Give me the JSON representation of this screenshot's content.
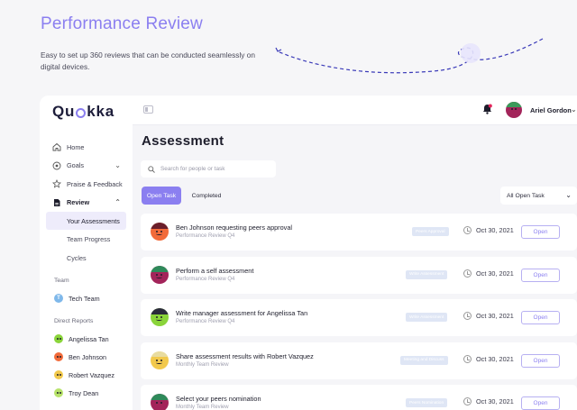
{
  "hero": {
    "title": "Performance Review",
    "subtitle": "Easy to set up 360 reviews that can be conducted seamlessly on digital devices."
  },
  "brand": {
    "logo_prefix": "Qu",
    "logo_suffix": "kka",
    "accent": "#8b7ff0"
  },
  "sidebar": {
    "nav": [
      {
        "label": "Home",
        "icon": "home-icon"
      },
      {
        "label": "Goals",
        "icon": "target-icon"
      },
      {
        "label": "Praise & Feedback",
        "icon": "star-icon"
      },
      {
        "label": "Review",
        "icon": "document-icon"
      }
    ],
    "review_sub": [
      "Your Assessments",
      "Team Progress",
      "Cycles"
    ],
    "team_label": "Team",
    "team": {
      "initial": "T",
      "name": "Tech Team"
    },
    "reports_label": "Direct Reports",
    "reports": [
      "Angelissa Tan",
      "Ben Johnson",
      "Robert Vazquez",
      "Troy Dean"
    ]
  },
  "topbar": {
    "user_name": "Ariel Gordon"
  },
  "main": {
    "title": "Assessment",
    "search_placeholder": "Search for people or task",
    "tabs": {
      "open": "Open Task",
      "completed": "Completed"
    },
    "filter": "All Open Task",
    "open_label": "Open",
    "tasks": [
      {
        "title": "Ben Johnson requesting peers approval",
        "subtitle": "Performance Review Q4",
        "badge": "Peers Approval",
        "date": "Oct 30, 2021",
        "avatar_color": "#f26b3a"
      },
      {
        "title": "Perform a self assessment",
        "subtitle": "Performance Review Q4",
        "badge": "Write Assessment",
        "date": "Oct 30, 2021",
        "avatar_color": "#a3245a"
      },
      {
        "title": "Write manager assessment for Angelissa Tan",
        "subtitle": "Performance Review Q4",
        "badge": "Write Assessment",
        "date": "Oct 30, 2021",
        "avatar_color": "#8ad43a"
      },
      {
        "title": "Share assessment results with Robert Vazquez",
        "subtitle": "Monthly Team Review",
        "badge": "Meeting and Discuss",
        "date": "Oct 30, 2021",
        "avatar_color": "#f2c94c"
      },
      {
        "title": "Select your peers nomination",
        "subtitle": "Monthly Team Review",
        "badge": "Peers Nomination",
        "date": "Oct 30, 2021",
        "avatar_color": "#a3245a"
      }
    ]
  }
}
